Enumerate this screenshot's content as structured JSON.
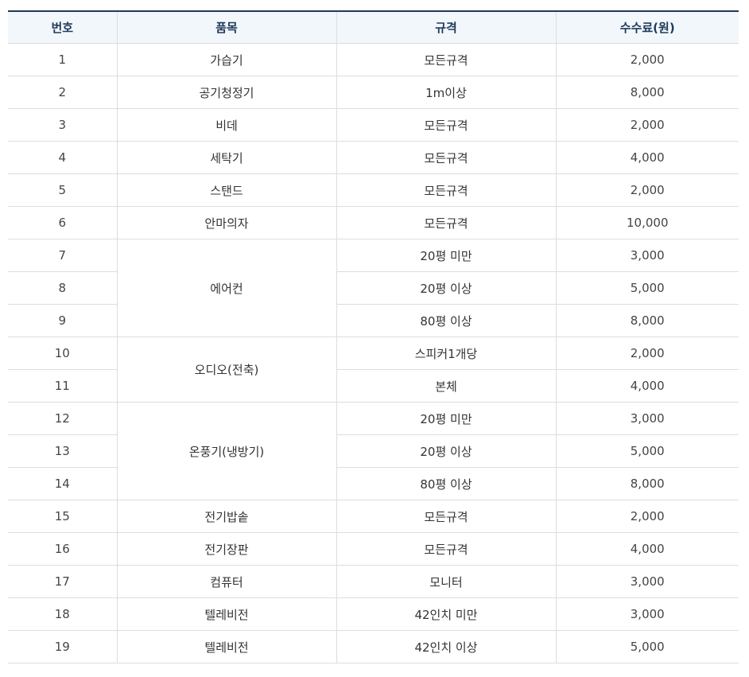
{
  "table": {
    "headers": {
      "number": "번호",
      "item": "품목",
      "spec": "규격",
      "fee": "수수료(원)"
    },
    "rows": [
      {
        "no": "1",
        "item": "가습기",
        "item_span": 1,
        "spec": "모든규격",
        "fee": "2,000"
      },
      {
        "no": "2",
        "item": "공기청정기",
        "item_span": 1,
        "spec": "1m이상",
        "fee": "8,000"
      },
      {
        "no": "3",
        "item": "비데",
        "item_span": 1,
        "spec": "모든규격",
        "fee": "2,000"
      },
      {
        "no": "4",
        "item": "세탁기",
        "item_span": 1,
        "spec": "모든규격",
        "fee": "4,000"
      },
      {
        "no": "5",
        "item": "스탠드",
        "item_span": 1,
        "spec": "모든규격",
        "fee": "2,000"
      },
      {
        "no": "6",
        "item": "안마의자",
        "item_span": 1,
        "spec": "모든규격",
        "fee": "10,000"
      },
      {
        "no": "7",
        "item": "에어컨",
        "item_span": 3,
        "spec": "20평 미만",
        "fee": "3,000"
      },
      {
        "no": "8",
        "item": null,
        "item_span": 0,
        "spec": "20평 이상",
        "fee": "5,000"
      },
      {
        "no": "9",
        "item": null,
        "item_span": 0,
        "spec": "80평 이상",
        "fee": "8,000"
      },
      {
        "no": "10",
        "item": "오디오(전축)",
        "item_span": 2,
        "spec": "스피커1개당",
        "fee": "2,000"
      },
      {
        "no": "11",
        "item": null,
        "item_span": 0,
        "spec": "본체",
        "fee": "4,000"
      },
      {
        "no": "12",
        "item": "온풍기(냉방기)",
        "item_span": 3,
        "spec": "20평 미만",
        "fee": "3,000"
      },
      {
        "no": "13",
        "item": null,
        "item_span": 0,
        "spec": "20평 이상",
        "fee": "5,000"
      },
      {
        "no": "14",
        "item": null,
        "item_span": 0,
        "spec": "80평 이상",
        "fee": "8,000"
      },
      {
        "no": "15",
        "item": "전기밥솥",
        "item_span": 1,
        "spec": "모든규격",
        "fee": "2,000"
      },
      {
        "no": "16",
        "item": "전기장판",
        "item_span": 1,
        "spec": "모든규격",
        "fee": "4,000"
      },
      {
        "no": "17",
        "item": "컴퓨터",
        "item_span": 1,
        "spec": "모니터",
        "fee": "3,000"
      },
      {
        "no": "18",
        "item": "텔레비전",
        "item_span": 1,
        "spec": "42인치 미만",
        "fee": "3,000"
      },
      {
        "no": "19",
        "item": "텔레비전",
        "item_span": 1,
        "spec": "42인치 이상",
        "fee": "5,000"
      }
    ]
  },
  "colors": {
    "header_bg": "#f2f7fb",
    "header_text": "#1f3a5a",
    "top_border": "#1f3a5a",
    "grid_line": "#dddddd"
  }
}
